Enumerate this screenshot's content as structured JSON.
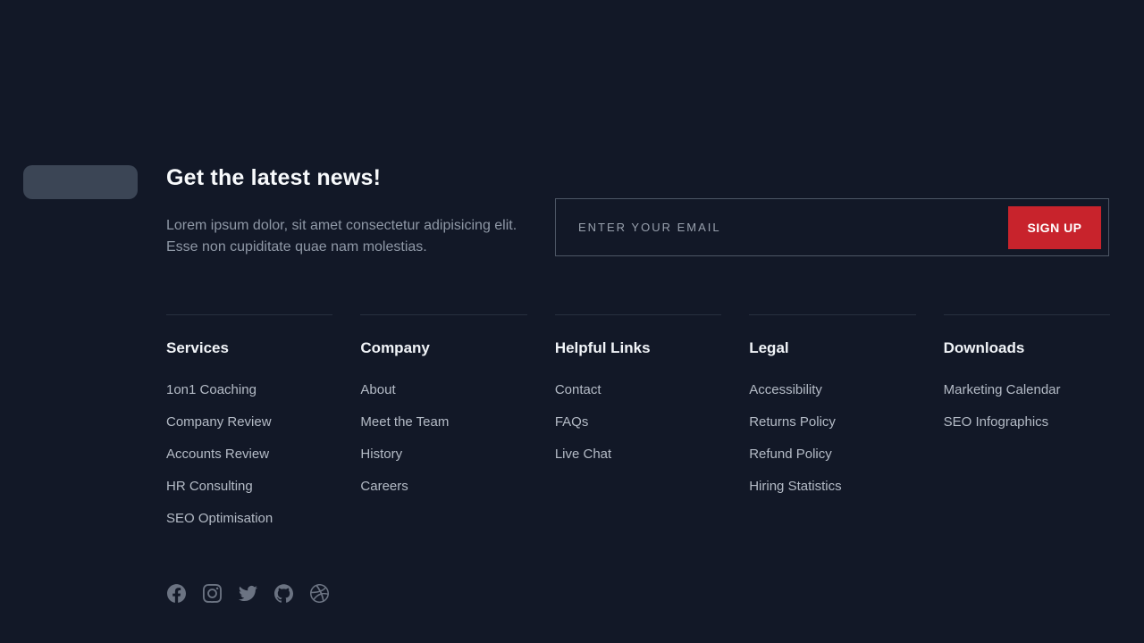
{
  "newsletter": {
    "heading": "Get the latest news!",
    "description": "Lorem ipsum dolor, sit amet consectetur adipisicing elit. Esse non cupiditate quae nam molestias.",
    "email_placeholder": "ENTER YOUR EMAIL",
    "signup_label": "SIGN UP"
  },
  "columns": [
    {
      "title": "Services",
      "links": [
        "1on1 Coaching",
        "Company Review",
        "Accounts Review",
        "HR Consulting",
        "SEO Optimisation"
      ]
    },
    {
      "title": "Company",
      "links": [
        "About",
        "Meet the Team",
        "History",
        "Careers"
      ]
    },
    {
      "title": "Helpful Links",
      "links": [
        "Contact",
        "FAQs",
        "Live Chat"
      ]
    },
    {
      "title": "Legal",
      "links": [
        "Accessibility",
        "Returns Policy",
        "Refund Policy",
        "Hiring Statistics"
      ]
    },
    {
      "title": "Downloads",
      "links": [
        "Marketing Calendar",
        "SEO Infographics"
      ]
    }
  ],
  "social": [
    "facebook",
    "instagram",
    "twitter",
    "github",
    "dribbble"
  ],
  "colors": {
    "background": "#121827",
    "accent_red": "#c8232c",
    "heading_text": "#f8fafc",
    "body_text": "#8f98a6",
    "link_text": "#b4bbc6",
    "divider": "#27303f",
    "icon_gray": "#6b7382",
    "logo_placeholder": "#3b4555"
  }
}
